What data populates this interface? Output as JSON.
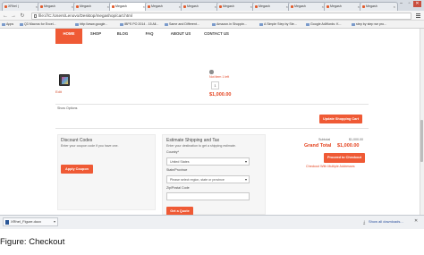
{
  "browser": {
    "tabs": [
      {
        "label": "XRhel |"
      },
      {
        "label": "Megash"
      },
      {
        "label": "Megash"
      },
      {
        "label": "Megash"
      },
      {
        "label": "Megash"
      },
      {
        "label": "Megash"
      },
      {
        "label": "Megash"
      },
      {
        "label": "Megash"
      },
      {
        "label": "Megash"
      },
      {
        "label": "Megash"
      },
      {
        "label": "Megash"
      }
    ],
    "url": "file:///C:/Users/Lenovo/Desktop/megashop/cart.html",
    "bookmarks": [
      {
        "label": "Apps"
      },
      {
        "label": "Q3 Macros for Excel..."
      },
      {
        "label": "http://www.google..."
      },
      {
        "label": "IBPS PO 2014 - 15 All..."
      },
      {
        "label": "Same and Different..."
      },
      {
        "label": "Amazon.in Shoppin..."
      },
      {
        "label": "A Simple Step by Ste..."
      },
      {
        "label": "Google AdWords: K..."
      },
      {
        "label": "step by step we pro..."
      }
    ]
  },
  "site": {
    "nav": [
      {
        "label": "HOME",
        "active": true
      },
      {
        "label": "SHOP",
        "active": false
      },
      {
        "label": "BLOG",
        "active": false
      },
      {
        "label": "FAQ",
        "active": false
      },
      {
        "label": "ABOUT US",
        "active": false
      },
      {
        "label": "CONTACT US",
        "active": false
      }
    ]
  },
  "cart": {
    "edit_label": "Edit",
    "stock_note": "Not item 1 left",
    "qty": "1",
    "price": "$1,000.00",
    "show_options": "Show Options",
    "update_button": "Update Shopping Cart"
  },
  "coupon": {
    "title": "Discount Codes",
    "subtitle": "Enter your coupon code if you have one.",
    "apply_button": "Apply Coupon"
  },
  "shipping": {
    "title": "Estimate Shipping and Tax",
    "subtitle": "Enter your destination to get a shipping estimate.",
    "country_label": "Country*",
    "country_value": "United States",
    "state_label": "State/Province",
    "state_value": "Please select region, state or province",
    "zip_label": "Zip/Postal Code",
    "quote_button": "Get a Quote"
  },
  "totals": {
    "subtotal_label": "Subtotal",
    "subtotal_value": "$1,000.00",
    "grand_label": "Grand Total",
    "grand_value": "$1,000.00",
    "checkout_button": "Proceed to Checkout",
    "multi_address_link": "Checkout With Multiple Addresses"
  },
  "downloads": {
    "file_name": "XRhel_Figure.docx",
    "show_all": "Show all downloads..."
  },
  "caption": "Figure: Checkout",
  "colors": {
    "accent": "#ef5a35",
    "price": "#e4431f"
  }
}
